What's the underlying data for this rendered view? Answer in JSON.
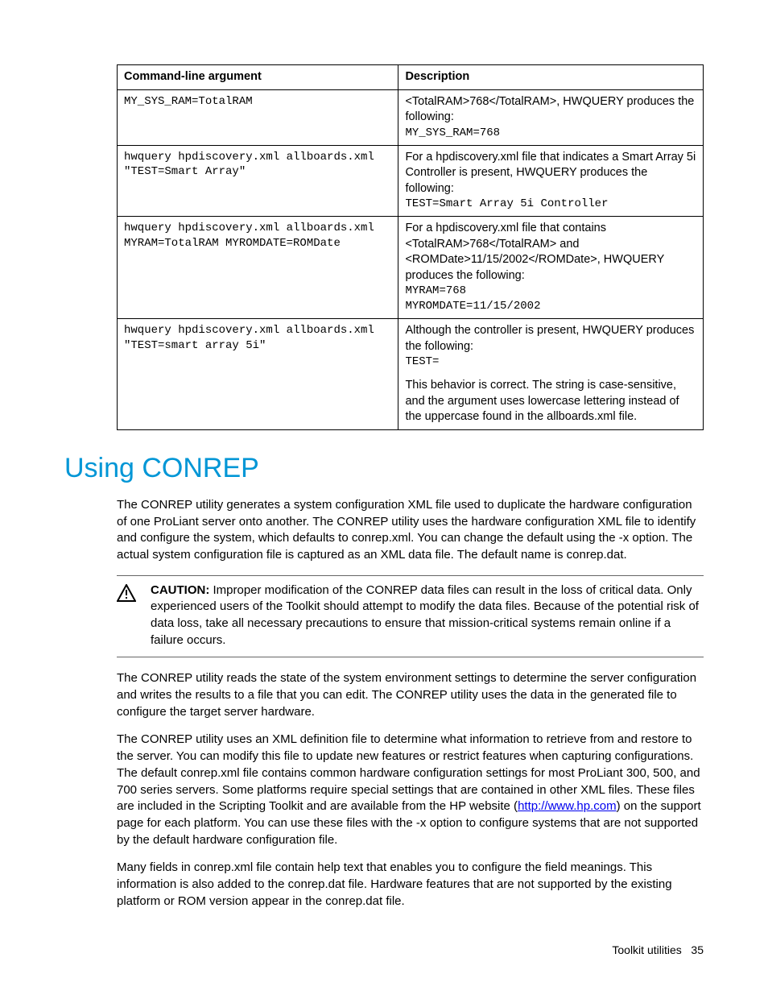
{
  "table": {
    "header_arg": "Command-line argument",
    "header_desc": "Description",
    "rows": [
      {
        "arg": "MY_SYS_RAM=TotalRAM",
        "desc_pre": "<TotalRAM>768</TotalRAM>, HWQUERY produces the following:",
        "desc_mono": "MY_SYS_RAM=768"
      },
      {
        "arg": "hwquery hpdiscovery.xml allboards.xml \"TEST=Smart Array\"",
        "desc_pre": "For a hpdiscovery.xml file that indicates a Smart Array 5i Controller is present, HWQUERY produces the following:",
        "desc_mono": "TEST=Smart Array 5i Controller"
      },
      {
        "arg": "hwquery hpdiscovery.xml allboards.xml MYRAM=TotalRAM MYROMDATE=ROMDate",
        "desc_pre": "For a hpdiscovery.xml file that contains <TotalRAM>768</TotalRAM> and <ROMDate>11/15/2002</ROMDate>, HWQUERY produces the following:",
        "desc_mono": "MYRAM=768",
        "desc_mono2": "MYROMDATE=11/15/2002"
      },
      {
        "arg": "hwquery hpdiscovery.xml allboards.xml \"TEST=smart array 5i\"",
        "desc_pre": "Although the controller is present, HWQUERY produces the following:",
        "desc_mono": "TEST=",
        "desc_after": "This behavior is correct. The string is case-sensitive, and the argument uses lowercase lettering instead of the uppercase found in the allboards.xml file."
      }
    ]
  },
  "heading": "Using CONREP",
  "para1": "The CONREP utility generates a system configuration XML file used to duplicate the hardware configuration of one ProLiant server onto another. The CONREP utility uses the hardware configuration XML file to identify and configure the system, which defaults to conrep.xml. You can change the default using the -x option. The actual system configuration file is captured as an XML data file. The default name is conrep.dat.",
  "caution_label": "CAUTION:",
  "caution_text": " Improper modification of the CONREP data files can result in the loss of critical data. Only experienced users of the Toolkit should attempt to modify the data files. Because of the potential risk of data loss, take all necessary precautions to ensure that mission-critical systems remain online if a failure occurs.",
  "para2": "The CONREP utility reads the state of the system environment settings to determine the server configuration and writes the results to a file that you can edit. The CONREP utility uses the data in the generated file to configure the target server hardware.",
  "para3_a": "The CONREP utility uses an XML definition file to determine what information to retrieve from and restore to the server. You can modify this file to update new features or restrict features when capturing configurations. The default conrep.xml file contains common hardware configuration settings for most ProLiant 300, 500, and 700 series servers. Some platforms require special settings that are contained in other XML files. These files are included in the Scripting Toolkit and are available from the HP website (",
  "para3_link": "http://www.hp.com",
  "para3_b": ") on the support page for each platform. You can use these files with the -x option to configure systems that are not supported by the default hardware configuration file.",
  "para4": "Many fields in conrep.xml file contain help text that enables you to configure the field meanings. This information is also added to the conrep.dat file. Hardware features that are not supported by the existing platform or ROM version appear in the conrep.dat file.",
  "footer_text": "Toolkit utilities",
  "footer_page": "35"
}
